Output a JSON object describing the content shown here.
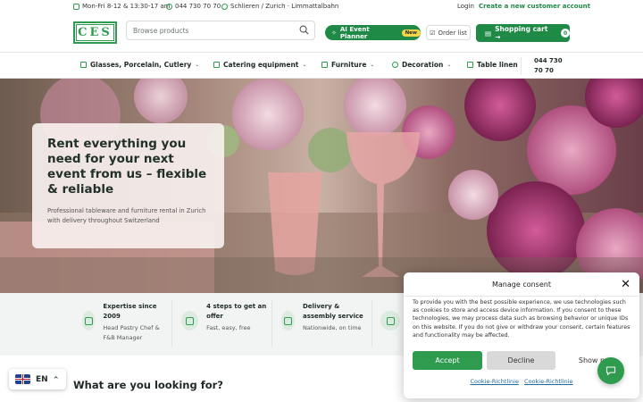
{
  "topbar": {
    "hours": "Mon-Fri 8-12 & 13:30-17 am",
    "phone": "044 730 70 70",
    "location": "Schlieren / Zurich · Limmattalbahn",
    "login": "Login",
    "create_account": "Create a new customer account"
  },
  "header": {
    "logo_text": "CES",
    "search_placeholder": "Browse products",
    "ai_planner": "AI Event Planner",
    "ai_badge": "New",
    "order_list": "Order list",
    "cart_label": "Shopping cart →",
    "cart_count": "0"
  },
  "nav": {
    "items": [
      {
        "label": "Glasses, Porcelain, Cutlery",
        "icon": "glass-icon"
      },
      {
        "label": "Catering equipment",
        "icon": "grid-icon"
      },
      {
        "label": "Furniture",
        "icon": "chair-icon"
      },
      {
        "label": "Decoration",
        "icon": "heart-icon"
      },
      {
        "label": "Table linen",
        "icon": "shield-icon"
      }
    ],
    "phone": "044 730 70 70"
  },
  "hero": {
    "title": "Rent everything you need for your next event from us – flexible & reliable",
    "subtitle": "Professional tableware and furniture rental in Zurich with delivery throughout Switzerland"
  },
  "features": [
    {
      "title": "Expertise since 2009",
      "subtitle": "Head Pastry Chef & F&B Manager",
      "icon": "shield-check-icon"
    },
    {
      "title": "4 steps to get an offer",
      "subtitle": "Fast, easy, free",
      "icon": "checklist-icon"
    },
    {
      "title": "Delivery & assembly service",
      "subtitle": "Nationwide, on time",
      "icon": "truck-icon"
    },
    {
      "title": "",
      "subtitle": "",
      "icon": "home-icon"
    }
  ],
  "language": {
    "code": "EN"
  },
  "section_heading": "What are you looking for?",
  "consent": {
    "title": "Manage consent",
    "body": "To provide you with the best possible experience, we use technologies such as cookies to store and access device information. If you consent to these technologies, we may process data such as browsing behavior or unique IDs on this website. If you do not give or withdraw your consent, certain features and functionality may be affected.",
    "accept": "Accept",
    "decline": "Decline",
    "preferences": "Show pre",
    "link1": "Cookie-Richtlinie",
    "link2": "Cookie-Richtlinie"
  },
  "colors": {
    "brand_green": "#1f8a45",
    "accent_green": "#2e9b4f",
    "badge_yellow": "#f6d44a"
  }
}
